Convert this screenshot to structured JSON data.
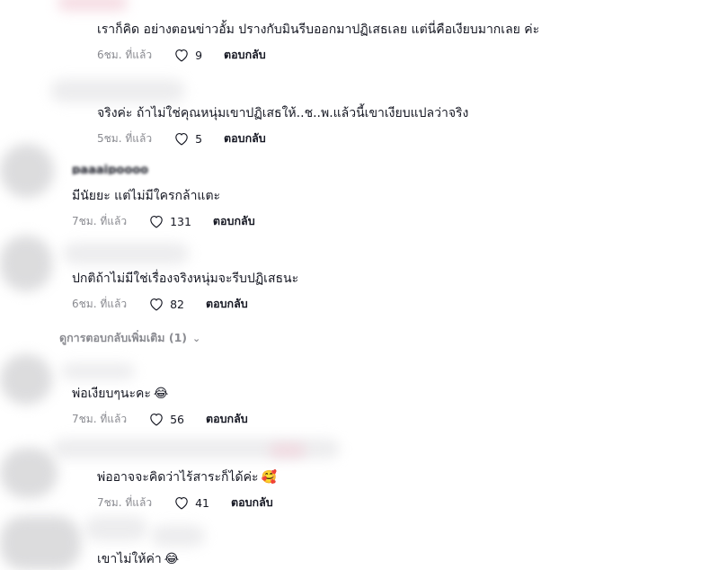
{
  "comments": [
    {
      "text": "เราก็คิด อย่างตอนข่าวอั้ม ปรางกับมินรีบออกมาปฏิเสธเลย แต่นี่คือเงียบมากเลย ค่ะ",
      "emoji": "",
      "time": "6ชม. ที่แล้ว",
      "likes": "9",
      "reply": "ตอบกลับ"
    },
    {
      "text": "จริงค่ะ ถ้าไม่ใช่คุณหนุ่มเขาปฏิเสธให้..ช..พ.แล้วนี้เขาเงียบแปลว่าจริง",
      "emoji": "",
      "time": "5ชม. ที่แล้ว",
      "likes": "5",
      "reply": "ตอบกลับ"
    },
    {
      "text": "มีนัยยะ แต่ไม่มีใครกล้าแตะ",
      "emoji": "",
      "time": "7ชม. ที่แล้ว",
      "likes": "131",
      "reply": "ตอบกลับ"
    },
    {
      "text": "ปกติถ้าไม่มีใช่เรื่องจริงหนุ่มจะรีบปฏิเสธนะ",
      "emoji": "",
      "time": "6ชม. ที่แล้ว",
      "likes": "82",
      "reply": "ตอบกลับ"
    },
    {
      "text": "พ่อเงียบๆนะคะ",
      "emoji": "😂",
      "time": "7ชม. ที่แล้ว",
      "likes": "56",
      "reply": "ตอบกลับ"
    },
    {
      "text": "พ่ออาจจะคิดว่าไร้สาระก็ได้ค่ะ",
      "emoji": "🥰",
      "time": "7ชม. ที่แล้ว",
      "likes": "41",
      "reply": "ตอบกลับ"
    },
    {
      "text": "เขาไม่ให้ค่า",
      "emoji": "😂",
      "time": "",
      "likes": "",
      "reply": ""
    }
  ],
  "view_more": "ดูการตอบกลับเพิ่มเติม (1)",
  "icons": {
    "like": "heart-outline-icon",
    "expand": "chevron-down-icon"
  },
  "colors": {
    "text": "#161823",
    "muted": "#8a8b91",
    "background": "#ffffff"
  }
}
